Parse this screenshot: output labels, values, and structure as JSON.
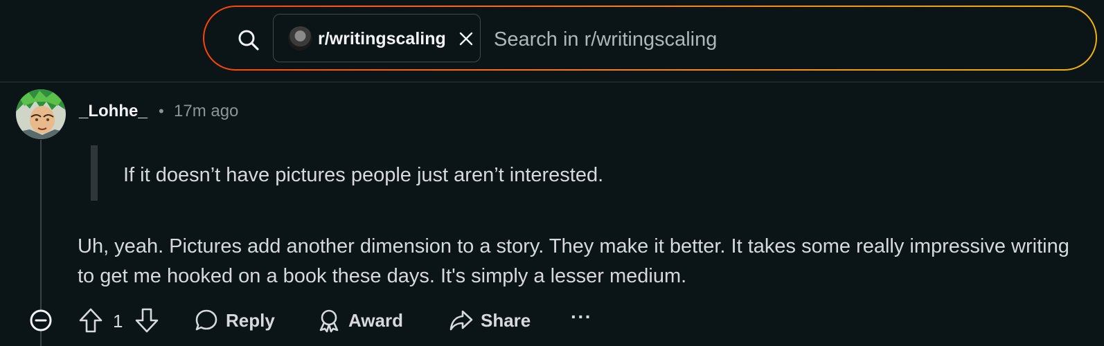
{
  "search": {
    "community_chip": "r/writingscaling",
    "placeholder": "Search in r/writingscaling"
  },
  "comment": {
    "author": "_Lohhe_",
    "separator": "•",
    "time_ago": "17m ago",
    "quote": "If it doesn’t have pictures people just aren’t interested.",
    "body": "Uh, yeah. Pictures add another dimension to a story. They make it better. It takes some really impressive writing to get me hooked on a book these days. It's simply a lesser medium."
  },
  "actions": {
    "vote_count": "1",
    "reply_label": "Reply",
    "award_label": "Award",
    "share_label": "Share",
    "more_label": "···"
  },
  "colors": {
    "background": "#0b1416",
    "search_gradient_start": "#ff4500",
    "search_gradient_end": "#f2b600",
    "text": "#d7dadc",
    "muted": "#8a9598"
  }
}
